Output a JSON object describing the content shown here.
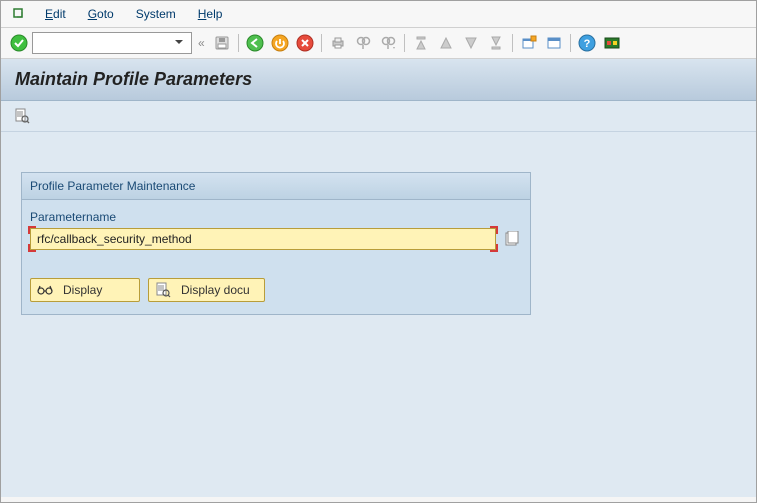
{
  "menu": {
    "edit": "Edit",
    "goto": "Goto",
    "system": "System",
    "help": "Help"
  },
  "toolbar": {
    "command_value": ""
  },
  "title": "Maintain Profile Parameters",
  "groupbox": {
    "title": "Profile Parameter Maintenance",
    "label": "Parametername",
    "value": "rfc/callback_security_method"
  },
  "buttons": {
    "display": "Display",
    "display_docu": "Display docu"
  }
}
